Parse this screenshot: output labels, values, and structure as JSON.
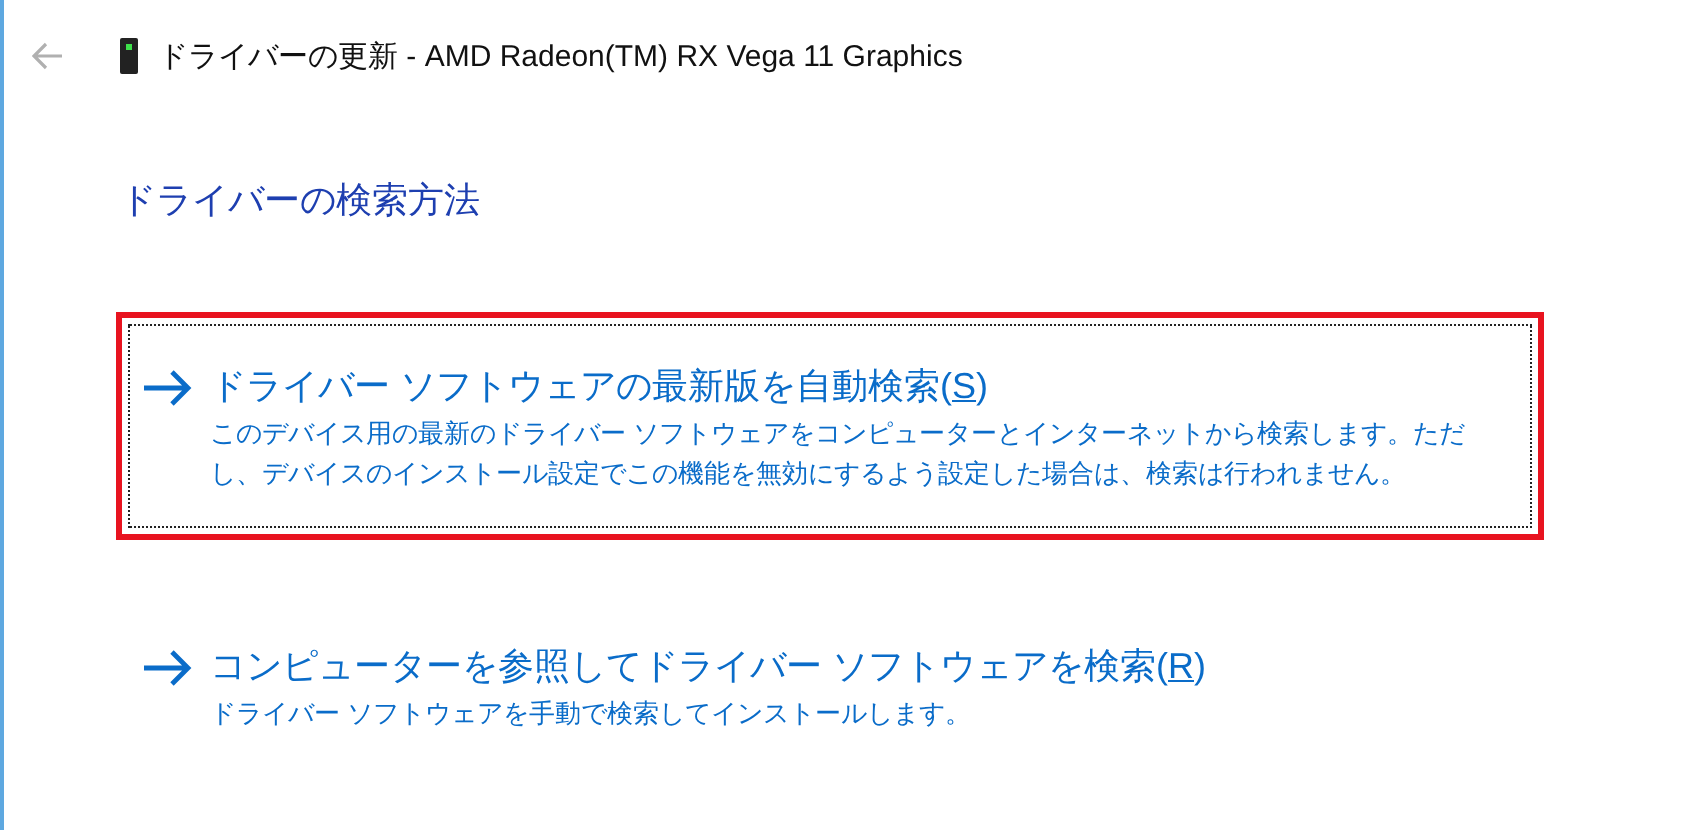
{
  "window": {
    "title": "ドライバーの更新 - AMD Radeon(TM) RX Vega 11 Graphics"
  },
  "heading": "ドライバーの検索方法",
  "options": [
    {
      "label_before": "ドライバー ソフトウェアの最新版を自動検索(",
      "access_key": "S",
      "label_after": ")",
      "description": "このデバイス用の最新のドライバー ソフトウェアをコンピューターとインターネットから検索します。ただし、デバイスのインストール設定でこの機能を無効にするよう設定した場合は、検索は行われません。",
      "selected": true
    },
    {
      "label_before": "コンピューターを参照してドライバー ソフトウェアを検索(",
      "access_key": "R",
      "label_after": ")",
      "description": "ドライバー ソフトウェアを手動で検索してインストールします。",
      "selected": false
    }
  ]
}
